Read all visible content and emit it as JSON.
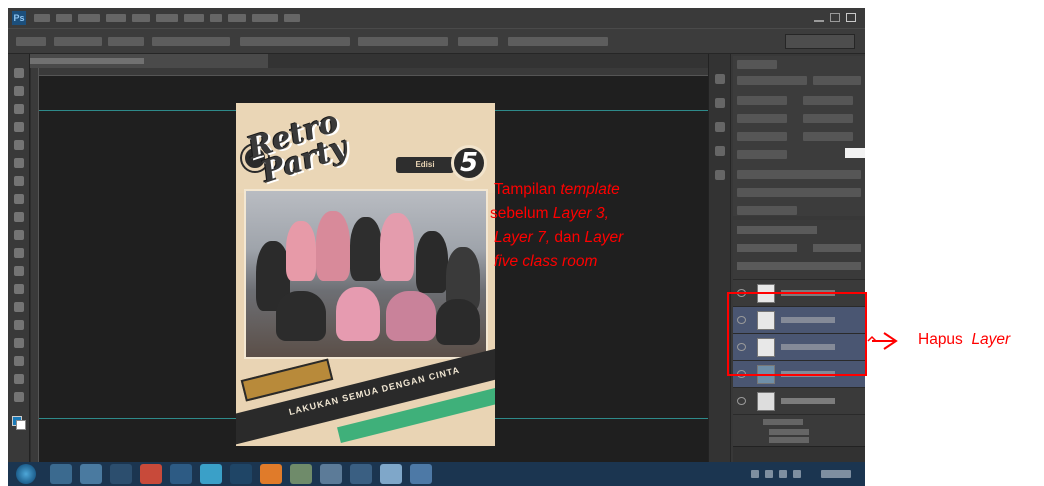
{
  "app": {
    "name": "Adobe Photoshop",
    "logo_text": "Ps"
  },
  "poster": {
    "title_line1": "Retro",
    "title_line2": "Party",
    "badge_word": "Edisi",
    "badge_number": "5",
    "banner_text": "LAKUKAN SEMUA DENGAN CINTA"
  },
  "caption": {
    "segments": [
      {
        "text": "Tampilan ",
        "italic": false
      },
      {
        "text": "template",
        "italic": true
      },
      {
        "text": " sebelum ",
        "italic": false
      },
      {
        "text": "Layer 3, Layer 7,",
        "italic": true
      },
      {
        "text": " dan ",
        "italic": false
      },
      {
        "text": "Layer five class room",
        "italic": true
      }
    ]
  },
  "annotation": {
    "label": "Hapus",
    "label_italic": "Layer"
  },
  "colors": {
    "annotation_red": "#ff0000",
    "workspace": "#2d2d2d",
    "canvas_bg": "#1f1f1f",
    "guide": "#2e8a8a",
    "selected_layer": "#4a5672",
    "taskbar": "#1b3550"
  }
}
